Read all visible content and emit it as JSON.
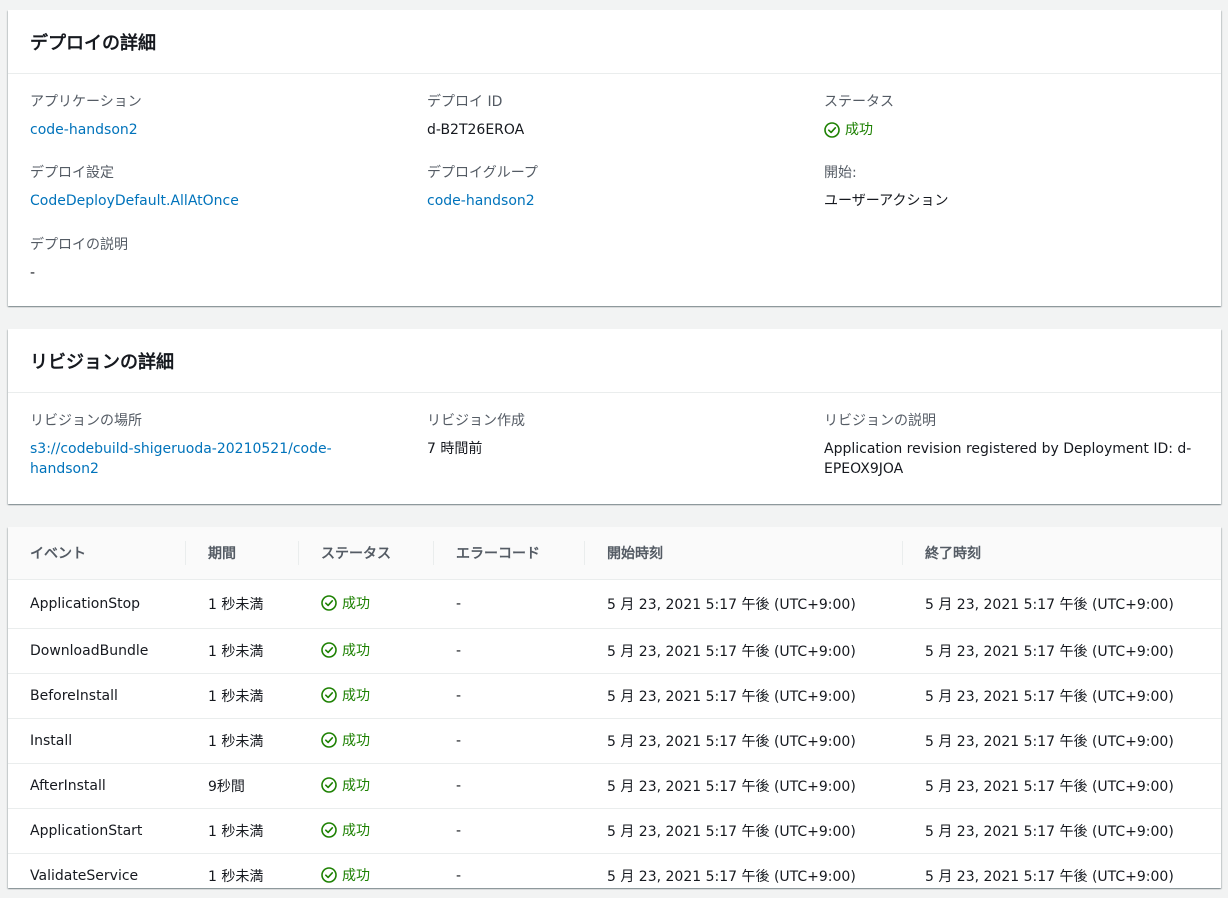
{
  "deploy": {
    "title": "デプロイの詳細",
    "application": {
      "label": "アプリケーション",
      "value": "code-handson2"
    },
    "deploy_id": {
      "label": "デプロイ ID",
      "value": "d-B2T26EROA"
    },
    "status": {
      "label": "ステータス",
      "value": "成功"
    },
    "config": {
      "label": "デプロイ設定",
      "value": "CodeDeployDefault.AllAtOnce"
    },
    "group": {
      "label": "デプロイグループ",
      "value": "code-handson2"
    },
    "start": {
      "label": "開始:",
      "value": "ユーザーアクション"
    },
    "description": {
      "label": "デプロイの説明",
      "value": "-"
    }
  },
  "revision": {
    "title": "リビジョンの詳細",
    "location": {
      "label": "リビジョンの場所",
      "line1": "s3://codebuild-shigeruoda-20210521/code-",
      "line2": "handson2"
    },
    "created": {
      "label": "リビジョン作成",
      "value": "7 時間前"
    },
    "description": {
      "label": "リビジョンの説明",
      "line1": "Application revision registered by Deployment ID: d-",
      "line2": "EPEOX9JOA"
    }
  },
  "events": {
    "headers": [
      "イベント",
      "期間",
      "ステータス",
      "エラーコード",
      "開始時刻",
      "終了時刻"
    ],
    "rows": [
      {
        "event": "ApplicationStop",
        "duration": "1 秒未満",
        "status": "成功",
        "error": "-",
        "start": "5 月 23, 2021 5:17 午後 (UTC+9:00)",
        "end": "5 月 23, 2021 5:17 午後 (UTC+9:00)"
      },
      {
        "event": "DownloadBundle",
        "duration": "1 秒未満",
        "status": "成功",
        "error": "-",
        "start": "5 月 23, 2021 5:17 午後 (UTC+9:00)",
        "end": "5 月 23, 2021 5:17 午後 (UTC+9:00)"
      },
      {
        "event": "BeforeInstall",
        "duration": "1 秒未満",
        "status": "成功",
        "error": "-",
        "start": "5 月 23, 2021 5:17 午後 (UTC+9:00)",
        "end": "5 月 23, 2021 5:17 午後 (UTC+9:00)"
      },
      {
        "event": "Install",
        "duration": "1 秒未満",
        "status": "成功",
        "error": "-",
        "start": "5 月 23, 2021 5:17 午後 (UTC+9:00)",
        "end": "5 月 23, 2021 5:17 午後 (UTC+9:00)"
      },
      {
        "event": "AfterInstall",
        "duration": "9秒間",
        "status": "成功",
        "error": "-",
        "start": "5 月 23, 2021 5:17 午後 (UTC+9:00)",
        "end": "5 月 23, 2021 5:17 午後 (UTC+9:00)"
      },
      {
        "event": "ApplicationStart",
        "duration": "1 秒未満",
        "status": "成功",
        "error": "-",
        "start": "5 月 23, 2021 5:17 午後 (UTC+9:00)",
        "end": "5 月 23, 2021 5:17 午後 (UTC+9:00)"
      },
      {
        "event": "ValidateService",
        "duration": "1 秒未満",
        "status": "成功",
        "error": "-",
        "start": "5 月 23, 2021 5:17 午後 (UTC+9:00)",
        "end": "5 月 23, 2021 5:17 午後 (UTC+9:00)"
      }
    ]
  },
  "colors": {
    "link": "#0073bb",
    "success": "#1d8102",
    "label": "#545b64",
    "text": "#16191f"
  },
  "icons": {
    "status_success": "check-circle-icon"
  }
}
